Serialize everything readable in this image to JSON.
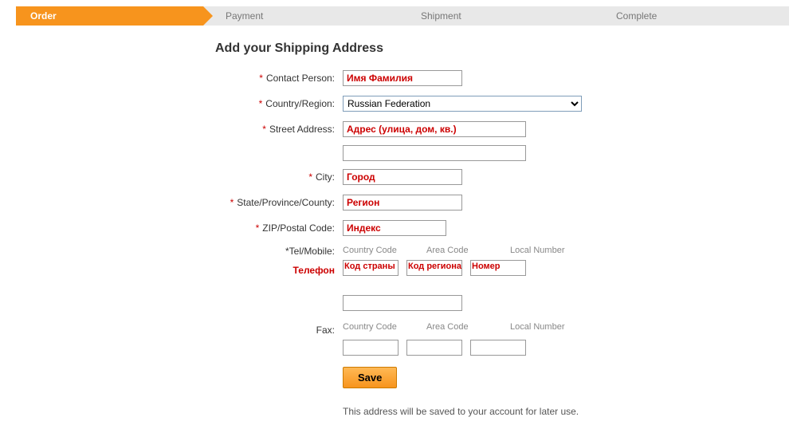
{
  "progress": {
    "steps": [
      {
        "label": "Order",
        "active": true
      },
      {
        "label": "Payment",
        "active": false
      },
      {
        "label": "Shipment",
        "active": false
      },
      {
        "label": "Complete",
        "active": false
      }
    ]
  },
  "heading": "Add your Shipping Address",
  "form": {
    "contact_person": {
      "label": "Contact Person:",
      "value": "Имя Фамилия"
    },
    "country": {
      "label": "Country/Region:",
      "selected": "Russian Federation"
    },
    "street": {
      "label": "Street Address:",
      "value": "Адрес (улица, дом, кв.)",
      "value2": ""
    },
    "city": {
      "label": "City:",
      "value": "Город"
    },
    "state": {
      "label": "State/Province/County:",
      "value": "Регион"
    },
    "zip": {
      "label": "ZIP/Postal Code:",
      "value": "Индекс"
    },
    "tel": {
      "label": "Tel/Mobile:",
      "col_cc": "Country Code",
      "col_ac": "Area Code",
      "col_ln": "Local Number",
      "ann_label": "Телефон",
      "ann_cc": "Код страны",
      "ann_ac": "Код региона",
      "ann_ln": "Номер",
      "cc": "",
      "ac": "",
      "ln": "",
      "extra": ""
    },
    "fax": {
      "label": "Fax:",
      "col_cc": "Country Code",
      "col_ac": "Area Code",
      "col_ln": "Local Number",
      "cc": "",
      "ac": "",
      "ln": ""
    },
    "save_label": "Save",
    "note": "This address will be saved to your account for later use."
  }
}
